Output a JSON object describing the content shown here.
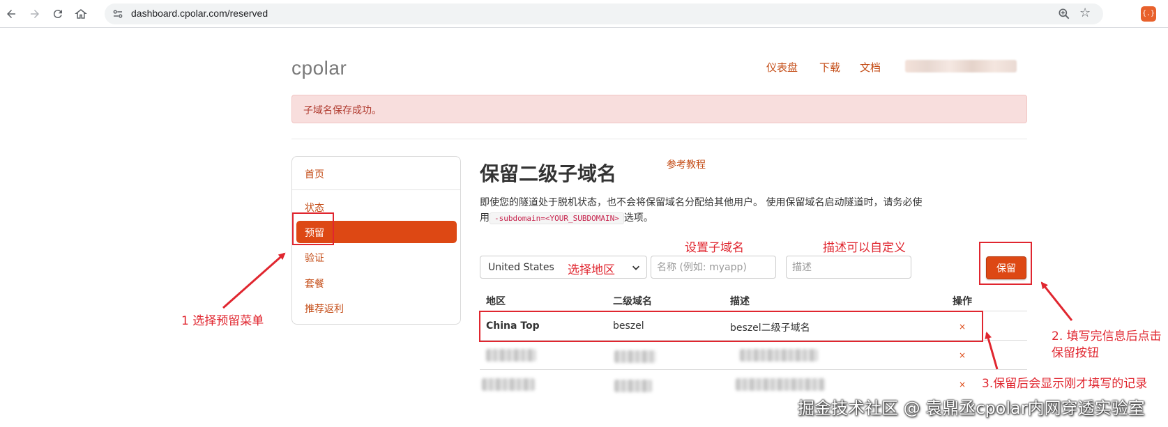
{
  "browser": {
    "url": "dashboard.cpolar.com/reserved",
    "ext_label": "{.}"
  },
  "header": {
    "logo": "cpolar",
    "nav": [
      "仪表盘",
      "下载",
      "文档"
    ]
  },
  "alert": {
    "message": "子域名保存成功。"
  },
  "sidebar": {
    "items": [
      {
        "label": "首页"
      },
      {
        "label": "状态"
      },
      {
        "label": "预留",
        "active": true
      },
      {
        "label": "验证"
      },
      {
        "label": "套餐"
      },
      {
        "label": "推荐返利"
      }
    ]
  },
  "main": {
    "title": "保留二级子域名",
    "tutorial_link": "参考教程",
    "desc_part1": "即使您的隧道处于脱机状态，也不会将保留域名分配给其他用户。 使用保留域名启动隧道时，请务必使用",
    "desc_code": "-subdomain=<YOUR_SUBDOMAIN>",
    "desc_part2": "选项。",
    "form": {
      "region_selected": "United States",
      "name_placeholder": "名称 (例如: myapp)",
      "desc_placeholder": "描述",
      "save_label": "保留"
    },
    "table": {
      "headers": [
        "地区",
        "二级域名",
        "描述",
        "操作"
      ],
      "rows": [
        {
          "region": "China Top",
          "subdomain": "beszel",
          "description": "beszel二级子域名",
          "action": "×"
        },
        {
          "region": "",
          "subdomain": "",
          "description": "",
          "action": "×",
          "blurred": true
        },
        {
          "region": "",
          "subdomain": "",
          "description": "",
          "action": "×",
          "blurred": true
        }
      ]
    }
  },
  "annotations": {
    "select_region": "选择地区",
    "set_subdomain": "设置子域名",
    "custom_desc": "描述可以自定义",
    "step1": "1 选择预留菜单",
    "step2_line1": "2. 填写完信息后点击",
    "step2_line2": "保留按钮",
    "step3": "3.保留后会显示刚才填写的记录",
    "color": "#e0262f"
  },
  "watermark": "掘金技术社区 @ 袁鼎丞cpolar内网穿透实验室"
}
